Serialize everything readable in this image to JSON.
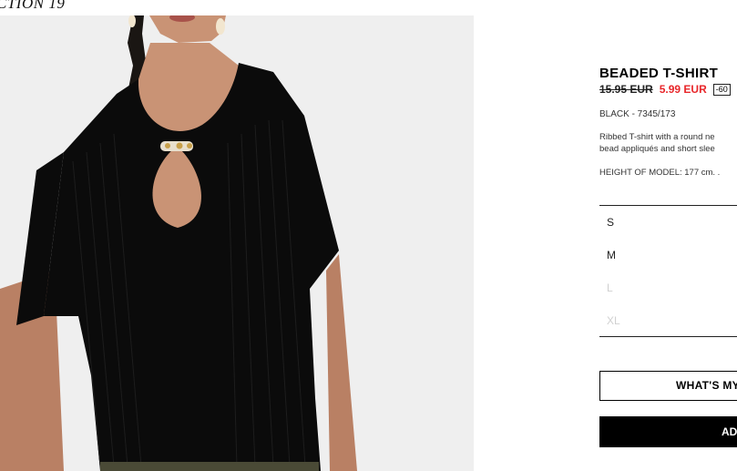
{
  "collection": {
    "label": "CTION 19"
  },
  "product": {
    "title": "BEADED T-SHIRT",
    "old_price": "15.95 EUR",
    "new_price": "5.99 EUR",
    "discount": "-60",
    "color_ref": "BLACK - 7345/173",
    "description_line1": "Ribbed T-shirt with a round ne",
    "description_line2": "bead appliqués and short slee",
    "model_height": "HEIGHT OF MODEL: 177 cm. ."
  },
  "sizes": [
    {
      "label": "S",
      "available": true
    },
    {
      "label": "M",
      "available": true
    },
    {
      "label": "L",
      "available": false
    },
    {
      "label": "XL",
      "available": false
    }
  ],
  "actions": {
    "fit_label": "WHAT'S MY",
    "add_label": "AD"
  },
  "colors": {
    "sale_price": "#e8262a",
    "garment": "#0b0b0b",
    "skin": "#c99375",
    "background": "#efefef",
    "unavailable_size": "#d0d0d0"
  }
}
